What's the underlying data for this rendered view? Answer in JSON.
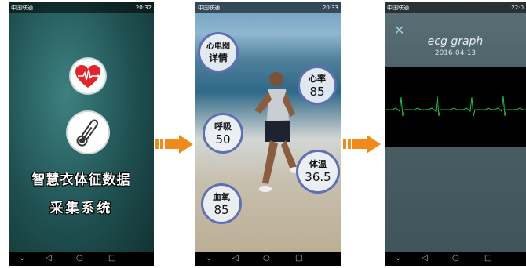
{
  "status_bar": [
    {
      "carrier": "中国联通",
      "time": "20:32"
    },
    {
      "carrier": "中国联通",
      "time": "20:33"
    },
    {
      "carrier": "中国联通",
      "time": "22:0"
    }
  ],
  "screen1": {
    "title_line1": "智慧衣体征数据",
    "title_line2": "采集系统",
    "heart_color": "#e0262b",
    "icons": [
      "heart-pulse-icon",
      "thermometer-icon"
    ]
  },
  "screen2": {
    "ecg_detail": {
      "line1": "心电图",
      "line2": "详情"
    },
    "heart_rate": {
      "label": "心率",
      "value": "85"
    },
    "breath": {
      "label": "呼吸",
      "value": "50"
    },
    "temperature": {
      "label": "体温",
      "value": "36.5"
    },
    "blood_oxygen": {
      "label": "血氧",
      "value": "85"
    }
  },
  "screen3": {
    "title": "ecg graph",
    "date": "2016-04-13",
    "trace_color": "#1fc04a"
  },
  "nav_icons": [
    "back-icon",
    "home-icon",
    "recents-icon"
  ],
  "arrow_color": "#f08a1c"
}
